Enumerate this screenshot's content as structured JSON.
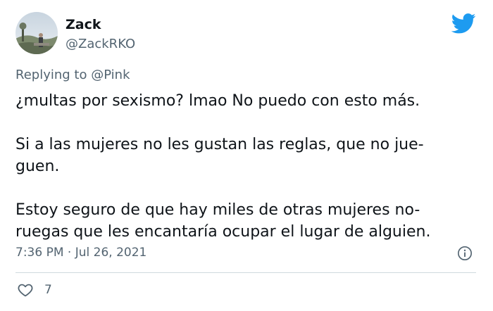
{
  "author": {
    "display_name": "Zack",
    "handle": "@ZackRKO",
    "avatar_icon": "profile-photo-icon"
  },
  "brand": {
    "icon": "twitter-bird-icon",
    "color": "#1d9bf0"
  },
  "reply": {
    "prefix": "Replying to ",
    "mention": "@Pink"
  },
  "tweet": {
    "lines": [
      "¿multas por sexismo? lmao No puedo con esto más.",
      "Si a las mujeres no les gustan las reglas, que no jue-guen.",
      "Estoy seguro de que hay miles de otras mujeres no-ruegas que les encantaría ocupar el lugar de alguien."
    ],
    "line_breaks": [
      [
        "¿multas por sexismo? lmao No puedo con esto más."
      ],
      [
        "Si a las mujeres no les gustan las reglas, que no jue-",
        "guen."
      ],
      [
        "Estoy seguro de que hay miles de otras mujeres no-",
        "ruegas que les encantaría ocupar el lugar de alguien."
      ]
    ]
  },
  "meta": {
    "time": "7:36 PM",
    "separator": " · ",
    "date": "Jul 26, 2021",
    "info_icon": "info-icon"
  },
  "actions": {
    "like_icon": "heart-icon",
    "like_count": "7"
  },
  "colors": {
    "text_primary": "#0f1419",
    "text_secondary": "#536471",
    "divider": "#cfd9de"
  }
}
